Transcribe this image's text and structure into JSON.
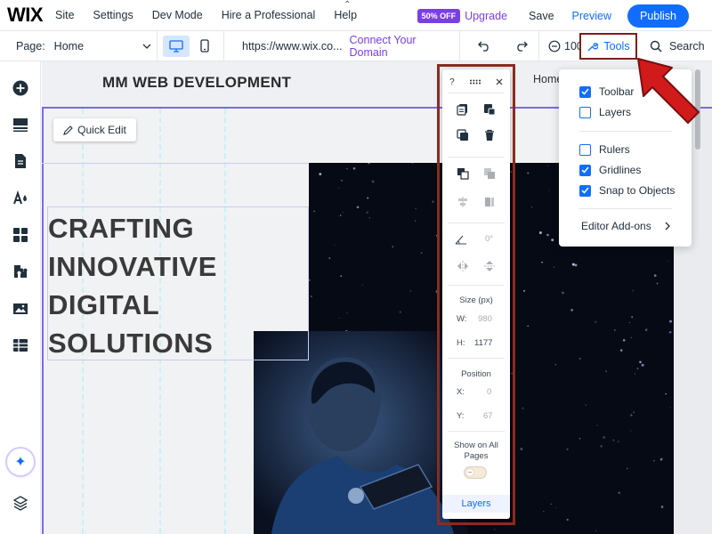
{
  "topbar": {
    "logo": "WIX",
    "menu": [
      "Site",
      "Settings",
      "Dev Mode",
      "Hire a Professional",
      "Help"
    ],
    "badge": "50% OFF",
    "upgrade": "Upgrade",
    "save": "Save",
    "preview": "Preview",
    "publish": "Publish"
  },
  "subbar": {
    "page_label": "Page:",
    "page_value": "Home",
    "url": "https://www.wix.co...",
    "connect_domain": "Connect Your Domain",
    "zoom": "100%",
    "tools": "Tools",
    "search": "Search"
  },
  "site": {
    "title": "MM WEB DEVELOPMENT",
    "home_link": "Home",
    "quick_edit": "Quick Edit",
    "headline": [
      "CRAFTING",
      "INNOVATIVE",
      "DIGITAL",
      "SOLUTIONS"
    ]
  },
  "panel": {
    "help": "?",
    "rotation_value": "0°",
    "size_label": "Size (px)",
    "w_label": "W:",
    "w_value": "980",
    "h_label": "H:",
    "h_value": "1177",
    "position_label": "Position",
    "x_label": "X:",
    "x_value": "0",
    "y_label": "Y:",
    "y_value": "67",
    "show_all_pages": "Show on All Pages",
    "layers": "Layers"
  },
  "tools_menu": {
    "toolbar": "Toolbar",
    "layers": "Layers",
    "rulers": "Rulers",
    "gridlines": "Gridlines",
    "snap": "Snap to Objects",
    "addons": "Editor Add-ons"
  },
  "colors": {
    "accent": "#116dff",
    "upgrade": "#7a3fe4",
    "highlight": "#8b2b1e",
    "arrow": "#d11a1a"
  }
}
